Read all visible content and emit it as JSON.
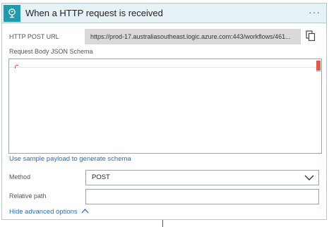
{
  "card": {
    "title": "When a HTTP request is received",
    "more_label": "···"
  },
  "fields": {
    "url_label": "HTTP POST URL",
    "url_value": "https://prod-17.australiasoutheast.logic.azure.com:443/workflows/461...",
    "schema_label": "Request Body JSON Schema",
    "schema_value": "",
    "sample_link": "Use sample payload to generate schema",
    "method_label": "Method",
    "method_value": "POST",
    "relative_path_label": "Relative path",
    "relative_path_value": "",
    "advanced_link": "Hide advanced options"
  },
  "colors": {
    "header_bg": "#e6f2f6",
    "icon_bg": "#1f9bb0",
    "link": "#2a6ebb",
    "url_box_bg": "#d9d9d9"
  },
  "icons": [
    "http-trigger-icon",
    "more-options-icon",
    "copy-icon",
    "chevron-down-icon",
    "chevron-up-icon"
  ]
}
